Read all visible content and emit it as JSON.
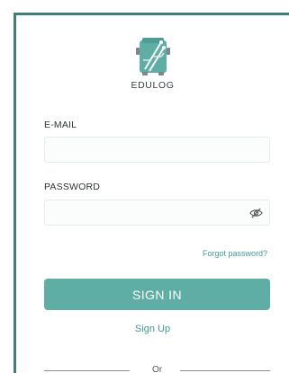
{
  "brand": {
    "name": "EDULOG"
  },
  "form": {
    "email_label": "E-MAIL",
    "email_value": "",
    "password_label": "PASSWORD",
    "password_value": "",
    "forgot_link": "Forgot password?",
    "signin_button": "SIGN IN",
    "signup_link": "Sign Up",
    "divider_text": "Or"
  },
  "colors": {
    "frame_border": "#3f7f79",
    "accent": "#5faea6",
    "link": "#3f9a92"
  },
  "icons": {
    "logo": "edulog-circuit-bus-logo",
    "password_toggle": "eye-slash-icon"
  }
}
